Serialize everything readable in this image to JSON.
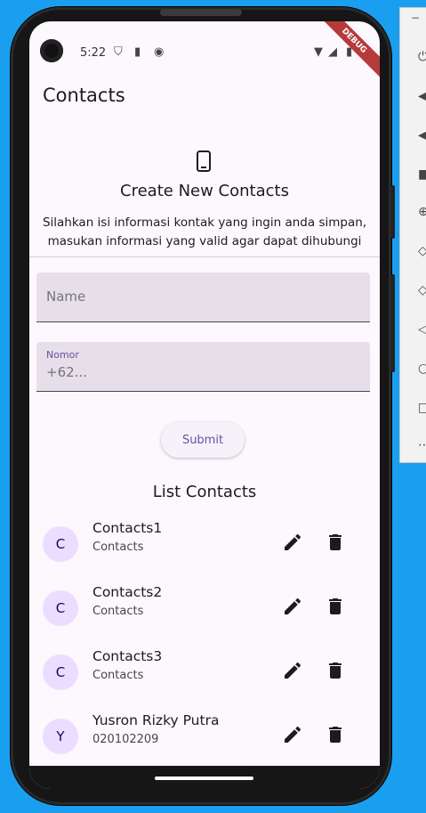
{
  "status": {
    "time": "5:22"
  },
  "debug_banner": "DEBUG",
  "app_bar": {
    "title": "Contacts"
  },
  "create": {
    "title": "Create New Contacts",
    "description_line1": "Silahkan isi informasi kontak yang ingin anda simpan,",
    "description_line2": "masukan informasi yang valid agar dapat dihubungi"
  },
  "form": {
    "name_placeholder": "Name",
    "nomor_label": "Nomor",
    "nomor_hint": "+62...",
    "submit_label": "Submit"
  },
  "list": {
    "title": "List Contacts",
    "items": [
      {
        "initial": "C",
        "name": "Contacts1",
        "number": "Contacts"
      },
      {
        "initial": "C",
        "name": "Contacts2",
        "number": "Contacts"
      },
      {
        "initial": "C",
        "name": "Contacts3",
        "number": "Contacts"
      },
      {
        "initial": "Y",
        "name": "Yusron Rizky Putra",
        "number": "020102209"
      }
    ]
  },
  "colors": {
    "surface": "#fdf7fe",
    "primary": "#6750a4",
    "avatar_bg": "#eaddff",
    "debug": "#b53b3b"
  }
}
